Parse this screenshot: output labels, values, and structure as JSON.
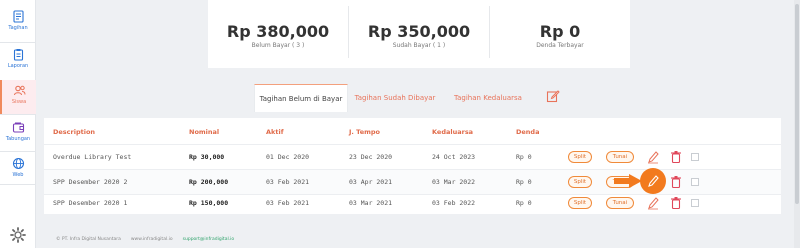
{
  "sidebar": {
    "items": [
      {
        "label": "Tagihan",
        "icon": "invoice-icon"
      },
      {
        "label": "Laporan",
        "icon": "clipboard-icon"
      },
      {
        "label": "Siswa",
        "icon": "users-icon"
      },
      {
        "label": "Tabungan",
        "icon": "wallet-icon"
      },
      {
        "label": "Web",
        "icon": "globe-icon"
      }
    ],
    "settings_icon": "gear-icon"
  },
  "stats": [
    {
      "value": "Rp 380,000",
      "label": "Belum Bayar ( 3 )"
    },
    {
      "value": "Rp 350,000",
      "label": "Sudah Bayar ( 1 )"
    },
    {
      "value": "Rp 0",
      "label": "Denda Terbayar"
    }
  ],
  "tabs": [
    {
      "label": "Tagihan Belum di Bayar",
      "active": true
    },
    {
      "label": "Tagihan Sudah Dibayar",
      "active": false
    },
    {
      "label": "Tagihan Kedaluarsa",
      "active": false
    }
  ],
  "table": {
    "columns": [
      "Description",
      "Nominal",
      "Aktif",
      "J. Tempo",
      "Kedaluarsa",
      "Denda"
    ],
    "rows": [
      {
        "description": "Overdue Library Test",
        "nominal": "Rp 30,000",
        "aktif": "01 Dec 2020",
        "tempo": "23 Dec 2020",
        "kedaluarsa": "24 Oct 2023",
        "denda": "Rp 0",
        "split": "Split",
        "tunai": "Tunai"
      },
      {
        "description": "SPP Desember 2020 2",
        "nominal": "Rp 200,000",
        "aktif": "03 Feb 2021",
        "tempo": "03 Apr 2021",
        "kedaluarsa": "03 Mar 2022",
        "denda": "Rp 0",
        "split": "Split",
        "tunai": "Tunai"
      },
      {
        "description": "SPP Desember 2020 1",
        "nominal": "Rp 150,000",
        "aktif": "03 Feb 2021",
        "tempo": "03 Mar 2021",
        "kedaluarsa": "03 Feb 2022",
        "denda": "Rp 0",
        "split": "Split",
        "tunai": "Tunai"
      }
    ]
  },
  "footer": {
    "company": "© PT. Infra Digital Nusantara",
    "website": "www.infradigital.io",
    "email": "support@infradigital.io"
  },
  "colors": {
    "accent": "#e8735a",
    "primary": "#2b74d6",
    "pill": "#f08a3a",
    "highlight": "#f27a1e"
  }
}
